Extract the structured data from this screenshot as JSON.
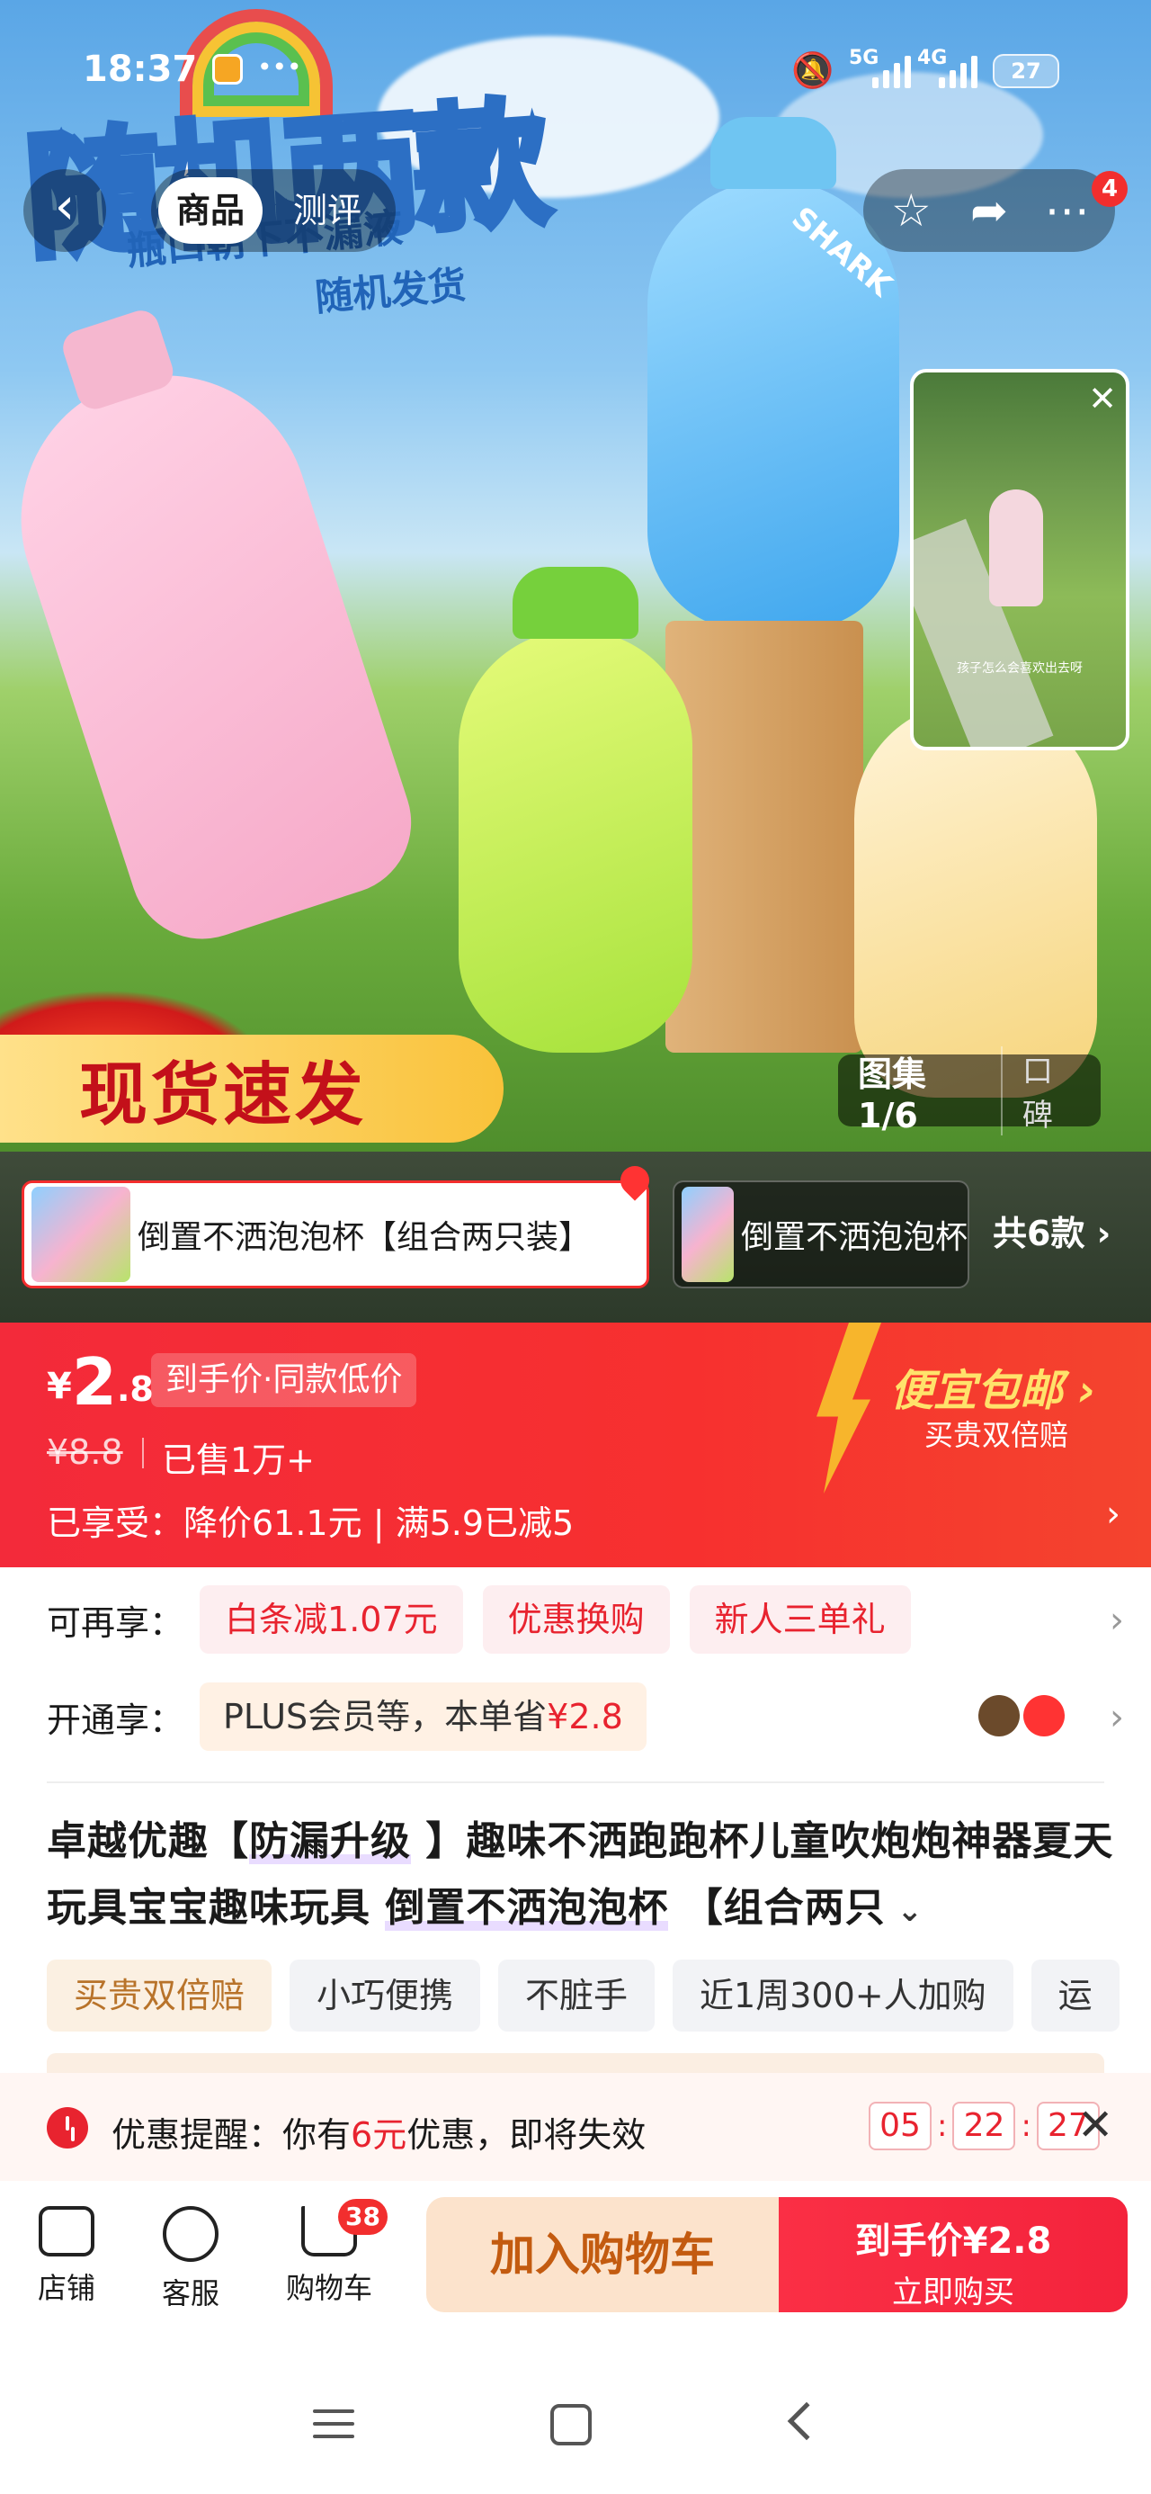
{
  "status_bar": {
    "time": "18:37",
    "network1": "5G",
    "network2": "4G",
    "battery": "27"
  },
  "hero": {
    "title": "随机两款",
    "subtitle1": "瓶口朝下不漏液",
    "subtitle2": "随机发货",
    "bottle_text": "SHARK",
    "promo": "现货速发"
  },
  "nav": {
    "tabs": [
      {
        "label": "商品"
      },
      {
        "label": "测评"
      }
    ],
    "message_badge": "4"
  },
  "video": {
    "caption": "孩子怎么会喜欢出去呀"
  },
  "gallery": {
    "label": "图集1/6",
    "reviews": "口碑"
  },
  "variants": {
    "items": [
      {
        "label": "倒置不洒泡泡杯【组合两只装】"
      },
      {
        "label": "倒置不洒泡泡杯"
      }
    ],
    "count": "共6款"
  },
  "price": {
    "currency": "¥",
    "int": "2",
    "dec": ".8",
    "tag": "到手价·同款低价",
    "original": "¥8.8",
    "sold": "已售1万+",
    "enjoyed": "已享受：降价61.1元 | 满5.9已减5",
    "shipping": "便宜包邮",
    "shipping_sub": "买贵双倍赔"
  },
  "offers": {
    "more_label": "可再享：",
    "chips": [
      "白条减1.07元",
      "优惠换购",
      "新人三单礼"
    ],
    "open_label": "开通享：",
    "plus_text": "PLUS会员等，本单省",
    "plus_save": "¥2.8"
  },
  "product": {
    "title_a": "卓越优趣【",
    "title_b": "防漏升级",
    "title_c": " 】趣味不洒跑跑杯儿童吹炮炮神器夏天玩具宝宝趣味玩具 ",
    "title_d": "倒置不洒泡泡杯",
    "title_e": " 【组合两只",
    "tags": [
      "买贵双倍赔",
      "小巧便携",
      "不脏手",
      "近1周300+人加购",
      "运"
    ]
  },
  "reminder": {
    "prefix": "优惠提醒：你有",
    "amount": "6元",
    "suffix": "优惠，即将失效",
    "h": "05",
    "m": "22",
    "s": "27"
  },
  "actions": {
    "store": "店铺",
    "service": "客服",
    "cart": "购物车",
    "cart_badge": "38",
    "add_cart": "加入购物车",
    "buy_line1": "到手价¥2.8",
    "buy_line2": "立即购买"
  },
  "colors": {
    "accent": "#f32a3a",
    "gold": "#b8732a",
    "cart_btn": "#fce3cc"
  }
}
